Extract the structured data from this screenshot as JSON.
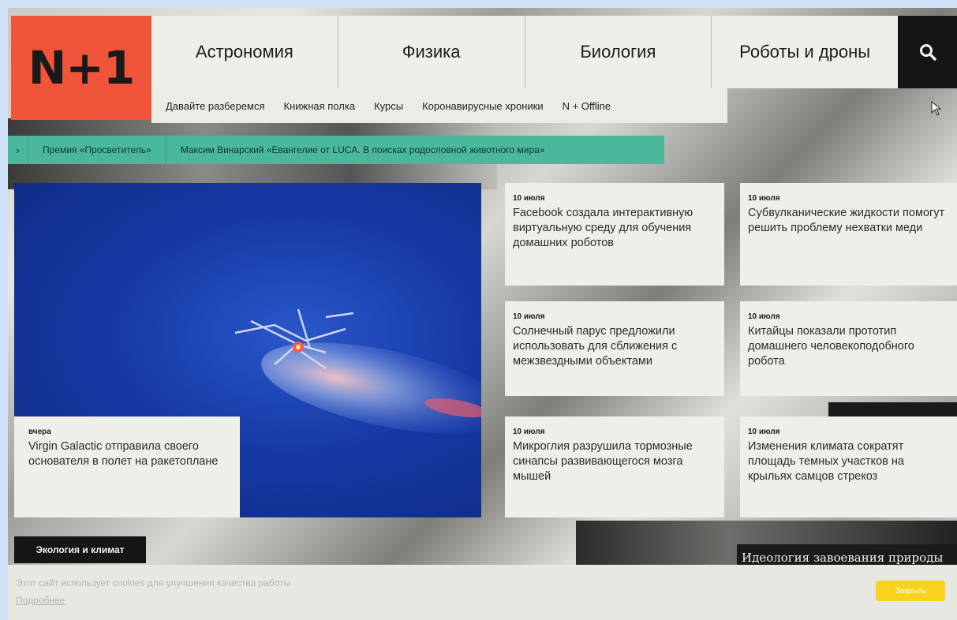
{
  "logo": {
    "text": "N+1"
  },
  "topnav": [
    "Астрономия",
    "Физика",
    "Биология",
    "Роботы и дроны"
  ],
  "subnav": [
    "Давайте разберемся",
    "Книжная полка",
    "Курсы",
    "Коронавирусные хроники",
    "N + Offline"
  ],
  "ticker": {
    "arrow": "›",
    "items": [
      "Премия «Просветитель»",
      "Максим Винарский «Евангелие от LUCA. В поисках родословной животного мира»"
    ]
  },
  "hero": {
    "date": "вчера",
    "title": "Virgin Galactic отправила своего основателя в полет на ракетоплане"
  },
  "news": [
    {
      "date": "10 июля",
      "title": "Facebook создала интерактивную виртуальную среду для обучения домашних роботов"
    },
    {
      "date": "10 июля",
      "title": "Субвулканические жидкости помогут решить проблему нехватки меди"
    },
    {
      "date": "10 июля",
      "title": "Солнечный парус предложили использовать для сближения с межзвездными объектами"
    },
    {
      "date": "10 июля",
      "title": "Китайцы показали прототип домашнего человекоподобного робота"
    },
    {
      "date": "10 июля",
      "title": "Микроглия разрушила тормозные синапсы развивающегося мозга мышей"
    },
    {
      "date": "10 июля",
      "title": "Изменения климата сократят площадь темных участков на крыльях самцов стрекоз"
    }
  ],
  "rubric": "Экология и климат",
  "feature": "Идеология завоевания природы",
  "cookie": {
    "text": "Этот сайт использует cookies для улучшения качества работы",
    "more": "Подробнее",
    "close": "Закрыть"
  },
  "icons": {
    "search": "search-icon",
    "cursor": "mouse-cursor-icon"
  },
  "colors": {
    "logo": "#f0543a",
    "ticker": "#4ab89a",
    "hero": "#1639a6",
    "close": "#f5d31f"
  }
}
